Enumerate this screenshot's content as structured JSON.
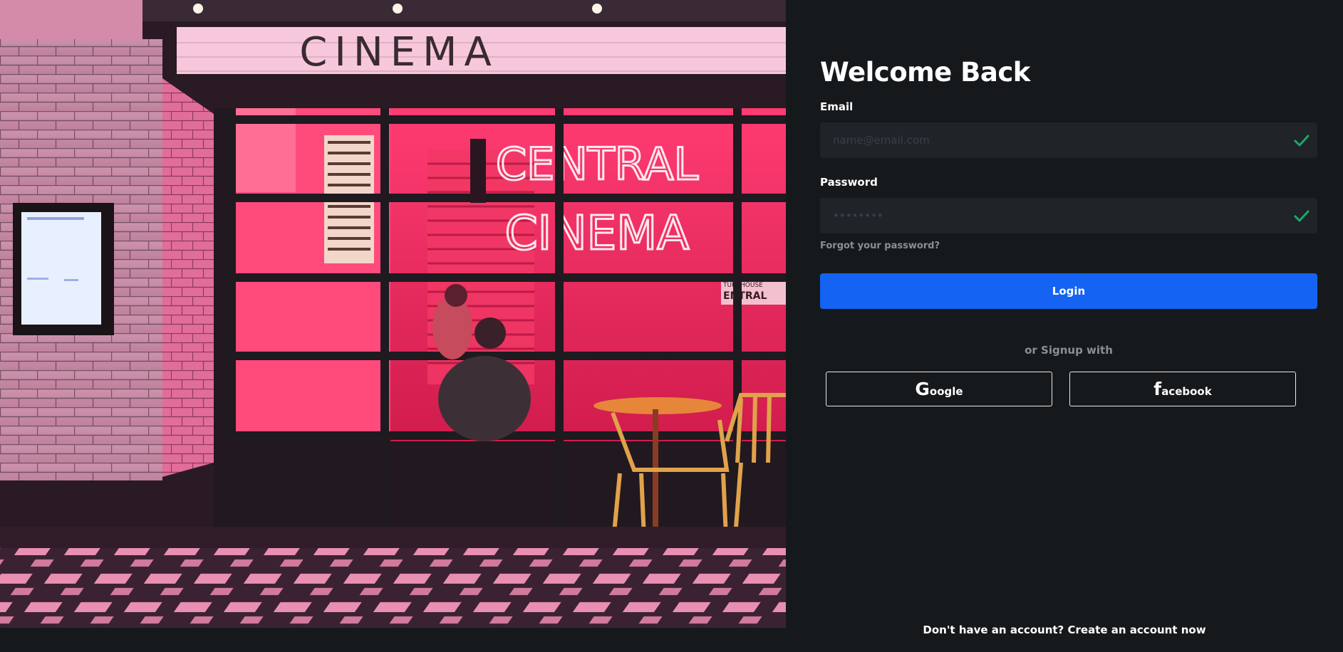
{
  "hero": {
    "marquee_text": "CINEMA",
    "neon_line1": "CENTRAL",
    "neon_line2": "CINEMA",
    "side_sign_line1": "TUREHOUSE",
    "side_sign_line2": "ENTRAL"
  },
  "form": {
    "title": "Welcome Back",
    "email": {
      "label": "Email",
      "value": "",
      "placeholder": "name@email.com"
    },
    "password": {
      "label": "Password",
      "value": "",
      "placeholder": "••••••••"
    },
    "forgot_label": "Forgot your password?",
    "login_label": "Login",
    "or_text": "or Signup with",
    "google": {
      "glyph": "G",
      "rest": "oogle"
    },
    "facebook": {
      "glyph": "f",
      "rest": "acebook"
    }
  },
  "footer": {
    "prompt": "Don't have an account?",
    "link": "Create an account now"
  },
  "icons": {
    "valid": "check-icon"
  },
  "colors": {
    "background": "#16191c",
    "input_bg": "#202328",
    "accent": "#1463f3",
    "valid": "#1fa866",
    "muted_text": "#8a8f96"
  }
}
